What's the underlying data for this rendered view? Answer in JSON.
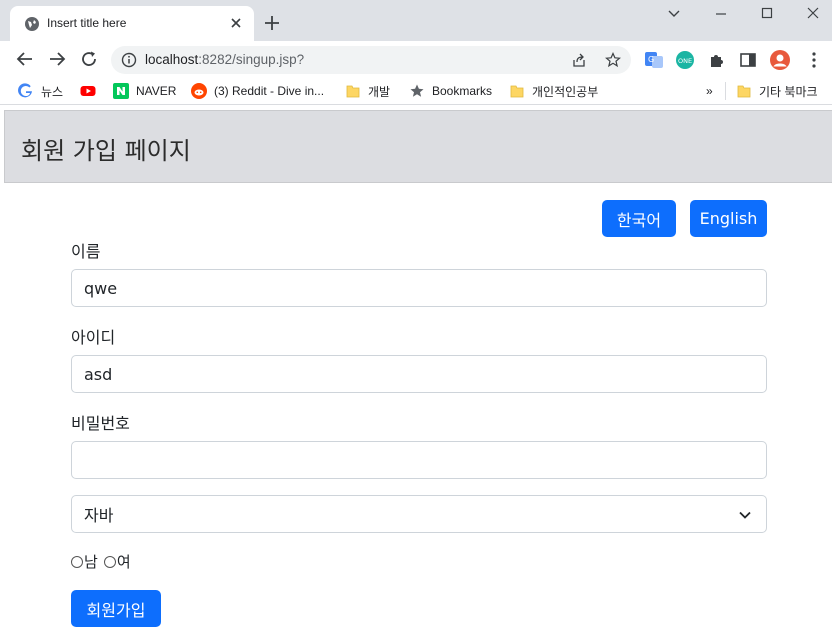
{
  "browser": {
    "tab": {
      "title": "Insert title here"
    },
    "url": {
      "host": "localhost",
      "rest": ":8282/singup.jsp?"
    },
    "bookmarks": [
      {
        "label": "뉴스",
        "icon": "google-icon"
      },
      {
        "label": "",
        "icon": "youtube-icon"
      },
      {
        "label": "NAVER",
        "icon": "naver-icon"
      },
      {
        "label": "(3) Reddit - Dive in...",
        "icon": "reddit-icon"
      },
      {
        "label": "개발",
        "icon": "folder-icon"
      },
      {
        "label": "Bookmarks",
        "icon": "star-icon"
      },
      {
        "label": "개인적인공부",
        "icon": "folder-icon"
      }
    ],
    "bookmarks_overflow": "»",
    "other_bookmarks": "기타 북마크"
  },
  "page": {
    "title": "회원 가입 페이지",
    "lang_buttons": {
      "korean": "한국어",
      "english": "English"
    },
    "form": {
      "name_label": "이름",
      "name_value": "qwe",
      "id_label": "아이디",
      "id_value": "asd",
      "password_label": "비밀번호",
      "password_value": "",
      "select_value": "자바",
      "gender_male": "남",
      "gender_female": "여",
      "submit_label": "회원가입"
    }
  },
  "colors": {
    "primary": "#0d6efd",
    "header_bg": "#dcdde1",
    "tabstrip_bg": "#dee1e6"
  }
}
